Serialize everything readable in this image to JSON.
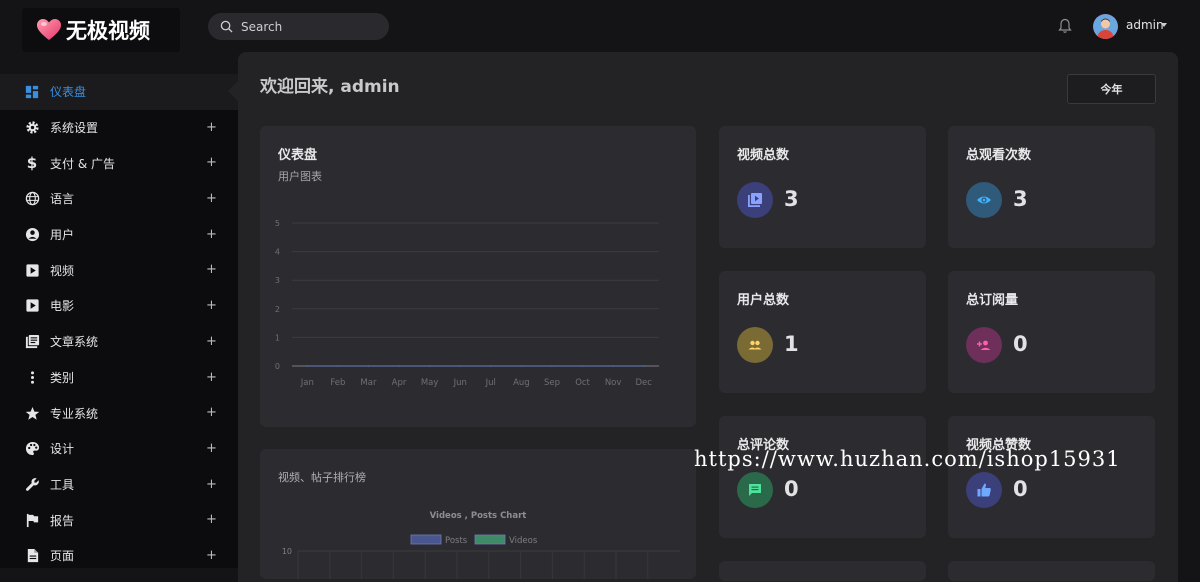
{
  "header": {
    "logo_text": "无极视频",
    "search_placeholder": "Search",
    "user_name": "admin"
  },
  "sidebar": {
    "items": [
      {
        "label": "仪表盘",
        "icon": "dashboard-icon",
        "active": true
      },
      {
        "label": "系统设置",
        "icon": "gear-icon"
      },
      {
        "label": "支付 & 广告",
        "icon": "dollar-icon"
      },
      {
        "label": "语言",
        "icon": "globe-icon"
      },
      {
        "label": "用户",
        "icon": "user-icon"
      },
      {
        "label": "视频",
        "icon": "video-icon"
      },
      {
        "label": "电影",
        "icon": "movie-icon"
      },
      {
        "label": "文章系统",
        "icon": "articles-icon"
      },
      {
        "label": "类别",
        "icon": "more-vertical-icon"
      },
      {
        "label": "专业系统",
        "icon": "star-icon"
      },
      {
        "label": "设计",
        "icon": "palette-icon"
      },
      {
        "label": "工具",
        "icon": "wrench-icon"
      },
      {
        "label": "报告",
        "icon": "flag-icon"
      },
      {
        "label": "页面",
        "icon": "page-icon"
      }
    ],
    "expand_symbol": "+"
  },
  "main": {
    "welcome": "欢迎回来, admin",
    "period_button": "今年",
    "chart_card": {
      "title": "仪表盘",
      "subtitle": "用户图表"
    },
    "rank_card": {
      "title": "视频、帖子排行榜"
    },
    "stats": [
      {
        "title": "视频总数",
        "value": "3",
        "icon": "video-library-icon",
        "color": "#3b3f7a"
      },
      {
        "title": "总观看次数",
        "value": "3",
        "icon": "eye-icon",
        "color": "#2f5a7a"
      },
      {
        "title": "用户总数",
        "value": "1",
        "icon": "people-icon",
        "color": "#7a6a34"
      },
      {
        "title": "总订阅量",
        "value": "0",
        "icon": "add-person-icon",
        "color": "#6e2f5a"
      },
      {
        "title": "总评论数",
        "value": "0",
        "icon": "comment-icon",
        "color": "#2a6a4a"
      },
      {
        "title": "视频总赞数",
        "value": "0",
        "icon": "thumbs-up-icon",
        "color": "#3b3f7a"
      }
    ]
  },
  "chart_data": [
    {
      "type": "line",
      "categories": [
        "Jan",
        "Feb",
        "Mar",
        "Apr",
        "May",
        "Jun",
        "Jul",
        "Aug",
        "Sep",
        "Oct",
        "Nov",
        "Dec"
      ],
      "values": [
        0,
        0,
        0,
        0,
        0,
        0,
        0,
        0,
        0,
        0,
        0,
        0
      ],
      "yticks": [
        "0",
        "1",
        "2",
        "3",
        "4",
        "5"
      ],
      "ylim": [
        0,
        5
      ],
      "grid": true
    },
    {
      "type": "bar",
      "title": "Videos , Posts Chart",
      "series": [
        {
          "name": "Posts",
          "color": "#4a5690"
        },
        {
          "name": "Videos",
          "color": "#3f8a67"
        }
      ],
      "yticks": [
        "10"
      ],
      "legend": "top"
    }
  ],
  "watermark": "https://www.huzhan.com/ishop15931"
}
